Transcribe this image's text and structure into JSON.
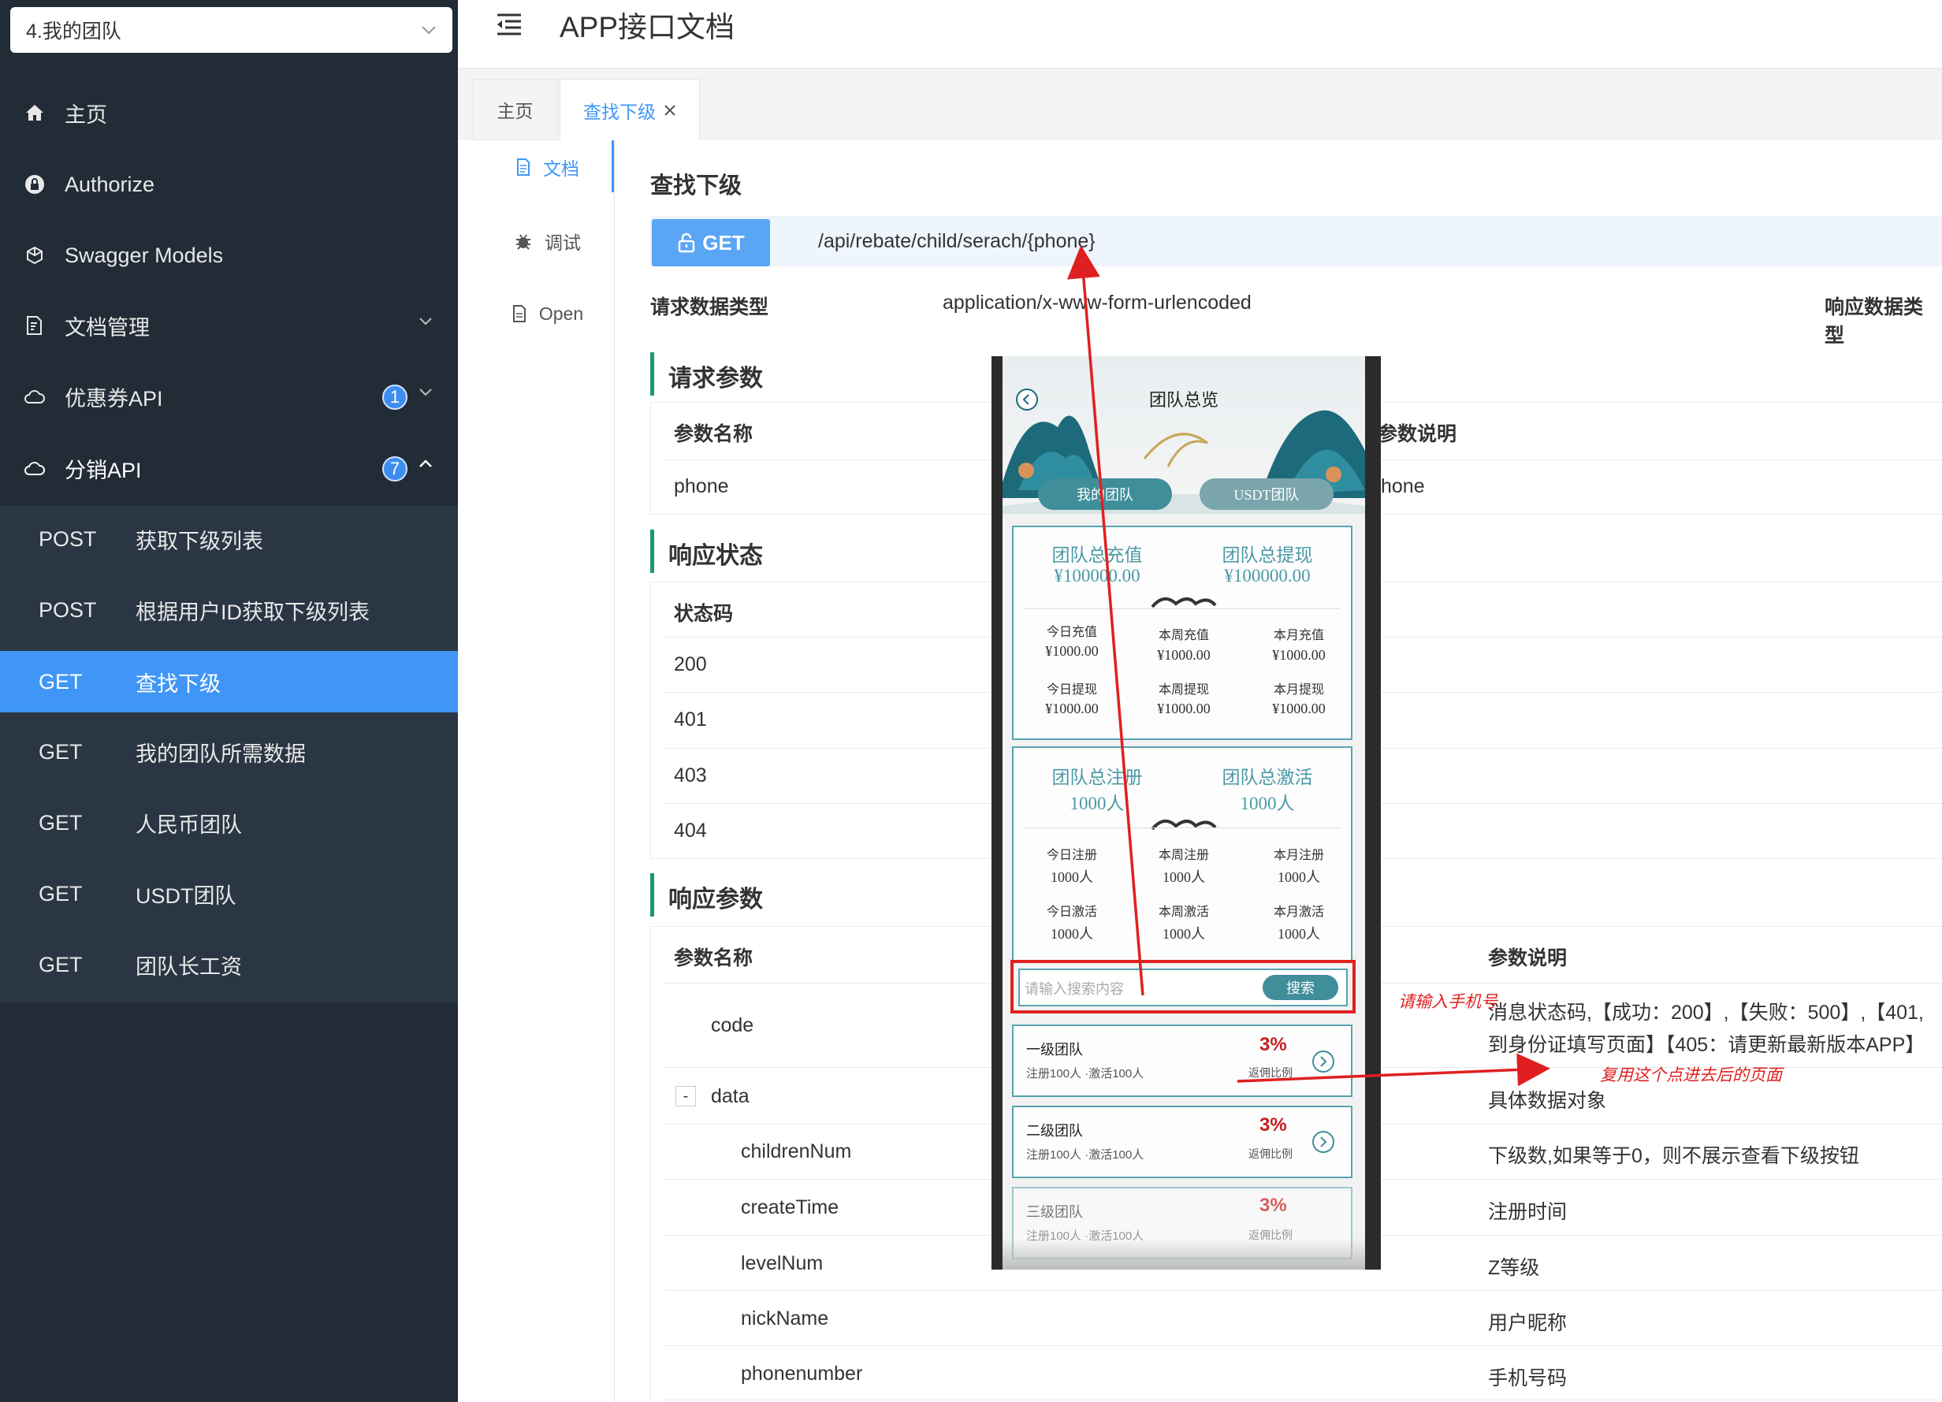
{
  "sidebar": {
    "group_select": "4.我的团队",
    "items": [
      {
        "label": "主页"
      },
      {
        "label": "Authorize"
      },
      {
        "label": "Swagger Models"
      },
      {
        "label": "文档管理"
      },
      {
        "label": "优惠券API",
        "badge": "1"
      },
      {
        "label": "分销API",
        "badge": "7"
      }
    ],
    "submenu": [
      {
        "method": "POST",
        "label": "获取下级列表"
      },
      {
        "method": "POST",
        "label": "根据用户ID获取下级列表"
      },
      {
        "method": "GET",
        "label": "查找下级"
      },
      {
        "method": "GET",
        "label": "我的团队所需数据"
      },
      {
        "method": "GET",
        "label": "人民币团队"
      },
      {
        "method": "GET",
        "label": "USDT团队"
      },
      {
        "method": "GET",
        "label": "团队长工资"
      }
    ]
  },
  "header": {
    "title": "APP接口文档"
  },
  "tabs": [
    {
      "label": "主页"
    },
    {
      "label": "查找下级"
    }
  ],
  "doc_tabs": [
    {
      "label": "文档"
    },
    {
      "label": "调试"
    },
    {
      "label": "Open"
    }
  ],
  "api": {
    "name": "查找下级",
    "method": "GET",
    "path": "/api/rebate/child/serach/{phone}",
    "req_type_label": "请求数据类型",
    "req_type_value": "application/x-www-form-urlencoded",
    "resp_type_label": "响应数据类型"
  },
  "request_params": {
    "title": "请求参数",
    "col_name": "参数名称",
    "col_desc": "参数说明",
    "rows": [
      {
        "name": "phone",
        "desc": "hone"
      }
    ]
  },
  "response_status": {
    "title": "响应状态",
    "col_code": "状态码",
    "codes": [
      "200",
      "401",
      "403",
      "404"
    ]
  },
  "response_params": {
    "title": "响应参数",
    "col_name": "参数名称",
    "col_desc": "参数说明",
    "rows": [
      {
        "name": "code",
        "desc": "消息状态码,【成功：200】,【失败：500】,【401,",
        "desc2": "到身份证填写页面】【405：请更新最新版本APP】"
      },
      {
        "name": "data",
        "desc": "具体数据对象",
        "toggle": "-"
      },
      {
        "name": "childrenNum",
        "desc": "下级数,如果等于0，则不展示查看下级按钮"
      },
      {
        "name": "createTime",
        "desc": "注册时间"
      },
      {
        "name": "levelNum",
        "desc": "Z等级"
      },
      {
        "name": "nickName",
        "desc": "用户昵称"
      },
      {
        "name": "phonenumber",
        "desc": "手机号码"
      }
    ]
  },
  "phone_mock": {
    "title": "团队总览",
    "tab_my": "我的团队",
    "tab_usdt": "USDT团队",
    "card1": {
      "left_title": "团队总充值",
      "left_value": "¥100000.00",
      "right_title": "团队总提现",
      "right_value": "¥100000.00",
      "stats": [
        {
          "label": "今日充值",
          "value": "¥1000.00"
        },
        {
          "label": "本周充值",
          "value": "¥1000.00"
        },
        {
          "label": "本月充值",
          "value": "¥1000.00"
        },
        {
          "label": "今日提现",
          "value": "¥1000.00"
        },
        {
          "label": "本周提现",
          "value": "¥1000.00"
        },
        {
          "label": "本月提现",
          "value": "¥1000.00"
        }
      ]
    },
    "card2": {
      "left_title": "团队总注册",
      "left_value": "1000人",
      "right_title": "团队总激活",
      "right_value": "1000人",
      "stats": [
        {
          "label": "今日注册",
          "value": "1000人"
        },
        {
          "label": "本周注册",
          "value": "1000人"
        },
        {
          "label": "本月注册",
          "value": "1000人"
        },
        {
          "label": "今日激活",
          "value": "1000人"
        },
        {
          "label": "本周激活",
          "value": "1000人"
        },
        {
          "label": "本月激活",
          "value": "1000人"
        }
      ]
    },
    "search_placeholder": "请输入搜索内容",
    "search_button": "搜索",
    "levels": [
      {
        "name": "一级团队",
        "sub": "注册100人 ·激活100人",
        "rate": "3%",
        "rate_label": "返佣比例"
      },
      {
        "name": "二级团队",
        "sub": "注册100人 ·激活100人",
        "rate": "3%",
        "rate_label": "返佣比例"
      },
      {
        "name": "三级团队",
        "sub": "注册100人 ·激活100人",
        "rate": "3%",
        "rate_label": "返佣比例"
      }
    ]
  },
  "annotations": {
    "note1": "请输入手机号",
    "note2": "复用这个点进去后的页面",
    "color": "#e02020"
  },
  "colors": {
    "sidebar": "#222c37",
    "active": "#4096f7",
    "accent_green": "#1a9a6c",
    "teal": "#4a9aa6"
  }
}
